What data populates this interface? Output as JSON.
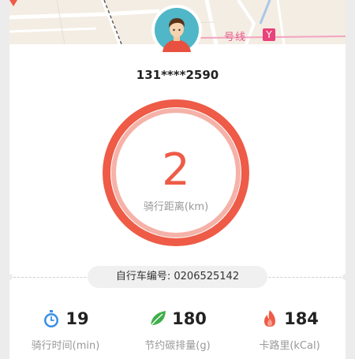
{
  "map": {
    "station_label": "号线",
    "metro_symbol": "Y"
  },
  "user": {
    "phone": "131****2590"
  },
  "distance": {
    "value": "2",
    "label": "骑行距离(km)"
  },
  "bike": {
    "number_text": "自行车编号: 0206525142"
  },
  "stats": [
    {
      "icon": "stopwatch-icon",
      "value": "19",
      "label": "骑行时间(min)",
      "color": "#3a8fe6"
    },
    {
      "icon": "leaf-icon",
      "value": "180",
      "label": "节约碳排量(g)",
      "color": "#3fae4a"
    },
    {
      "icon": "flame-icon",
      "value": "184",
      "label": "卡路里(kCal)",
      "color": "#ee5b47"
    }
  ],
  "colors": {
    "accent": "#ee5b47",
    "ring_inner": "#f5b2a8",
    "background": "#ececec"
  }
}
